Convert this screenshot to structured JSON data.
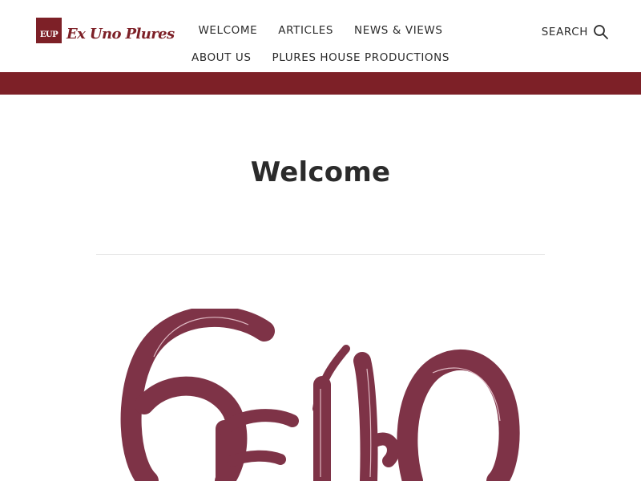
{
  "site": {
    "logo_mark": "EUP",
    "logo_text": "Ex Uno Plures"
  },
  "nav": {
    "items": [
      {
        "label": "WELCOME"
      },
      {
        "label": "ARTICLES"
      },
      {
        "label": "NEWS & VIEWS"
      },
      {
        "label": "ABOUT US"
      },
      {
        "label": "PLURES HOUSE PRODUCTIONS"
      }
    ]
  },
  "search": {
    "label": "SEARCH",
    "icon": "search-icon"
  },
  "main": {
    "title": "Welcome"
  },
  "colors": {
    "brand": "#7d2027",
    "hello_art": "#7e3347",
    "text": "#2b2b2b"
  }
}
